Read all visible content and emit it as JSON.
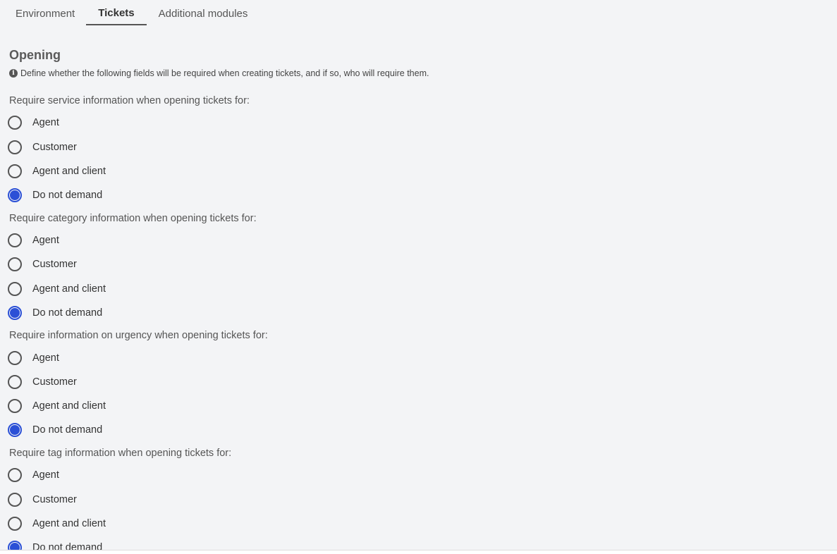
{
  "tabs": [
    {
      "label": "Environment",
      "active": false
    },
    {
      "label": "Tickets",
      "active": true
    },
    {
      "label": "Additional modules",
      "active": false
    }
  ],
  "section": {
    "title": "Opening",
    "hint": "Define whether the following fields will be required when creating tickets, and if so, who will require them.",
    "hint_icon": "info-icon"
  },
  "groups": [
    {
      "label": "Require service information when opening tickets for:",
      "options": [
        "Agent",
        "Customer",
        "Agent and client",
        "Do not demand"
      ],
      "selected": "Do not demand"
    },
    {
      "label": "Require category information when opening tickets for:",
      "options": [
        "Agent",
        "Customer",
        "Agent and client",
        "Do not demand"
      ],
      "selected": "Do not demand"
    },
    {
      "label": "Require information on urgency when opening tickets for:",
      "options": [
        "Agent",
        "Customer",
        "Agent and client",
        "Do not demand"
      ],
      "selected": "Do not demand"
    },
    {
      "label": "Require tag information when opening tickets for:",
      "options": [
        "Agent",
        "Customer",
        "Agent and client",
        "Do not demand"
      ],
      "selected": "Do not demand"
    }
  ],
  "colors": {
    "background": "#f3f4f6",
    "accent": "#2b50d6",
    "text": "#333333"
  }
}
